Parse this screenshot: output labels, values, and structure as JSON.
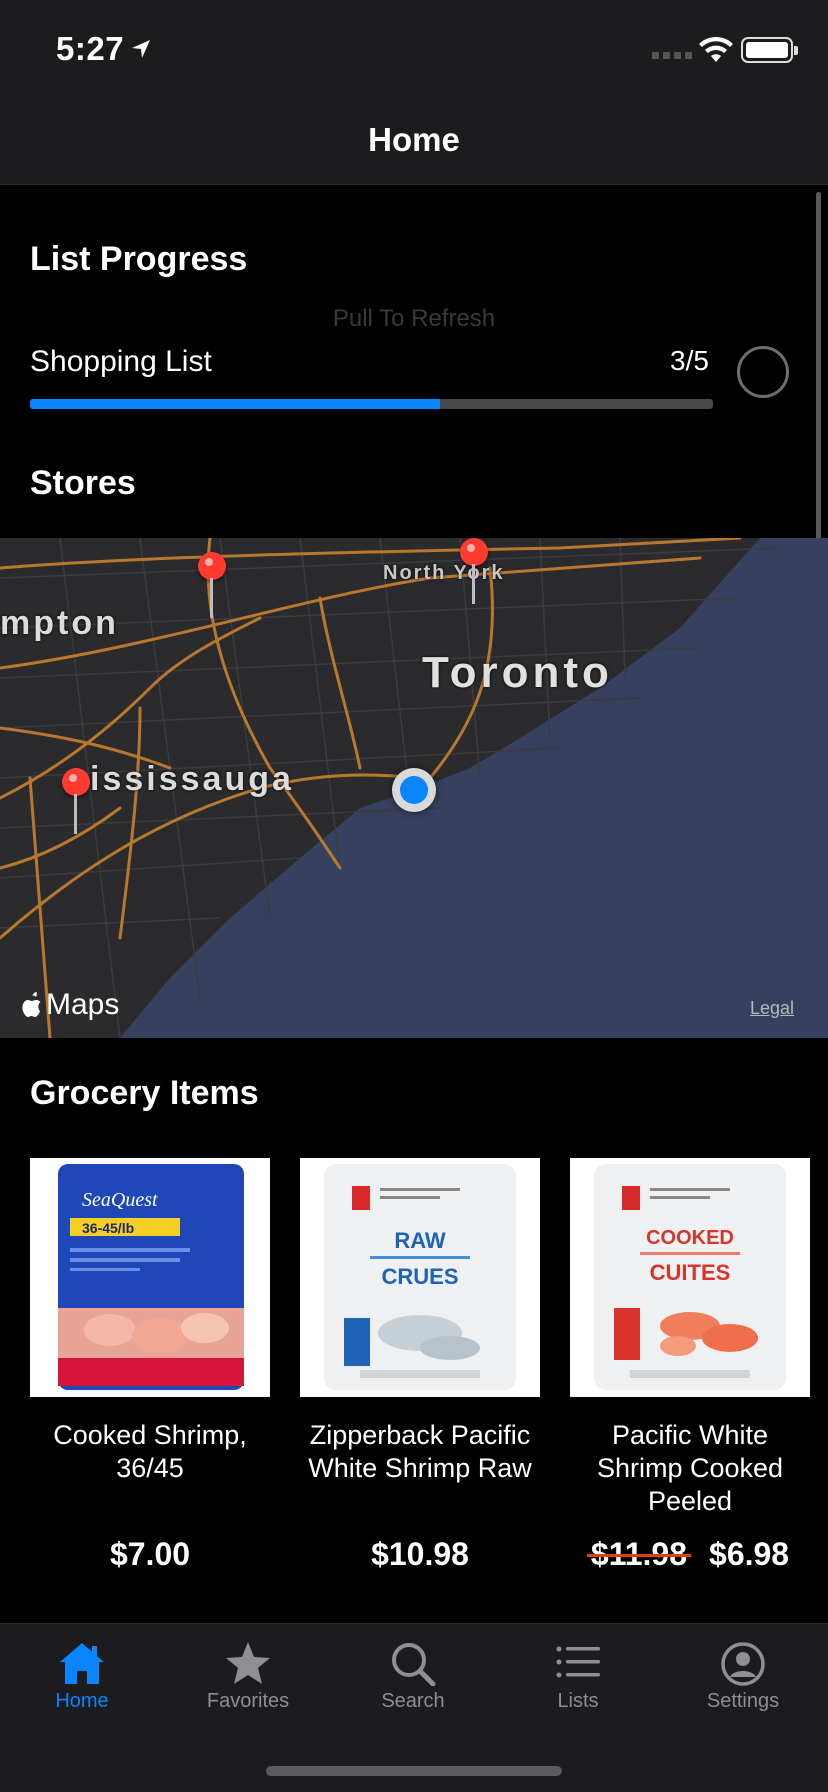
{
  "status": {
    "time": "5:27"
  },
  "nav": {
    "title": "Home"
  },
  "list_progress": {
    "title": "List Progress",
    "pull_to_refresh": "Pull To Refresh",
    "list_name": "Shopping List",
    "count": "3/5",
    "progress": 0.6
  },
  "stores": {
    "title": "Stores",
    "map_labels": {
      "north_york": "North York",
      "toronto": "Toronto",
      "mississauga": "ississauga",
      "brampton": "mpton"
    },
    "maps_brand": "Maps",
    "legal": "Legal"
  },
  "grocery": {
    "title": "Grocery Items",
    "items": [
      {
        "name": "Cooked Shrimp, 36/45",
        "price": "$7.00",
        "image": "seaquest-shrimp-bag"
      },
      {
        "name": "Zipperback Pacific White Shrimp Raw",
        "price": "$10.98",
        "image": "pc-raw-shrimp-bag"
      },
      {
        "name": "Pacific White Shrimp Cooked Peeled",
        "old_price": "$11.98",
        "price": "$6.98",
        "image": "pc-cooked-shrimp-bag"
      }
    ],
    "package_text": {
      "seaquest_brand": "SeaQuest",
      "seaquest_count": "36-45/lb",
      "pc_raw_label": "RAW",
      "pc_raw_fr": "CRUES",
      "pc_cooked_label": "COOKED",
      "pc_cooked_fr": "CUITES"
    }
  },
  "tabs": [
    {
      "label": "Home",
      "icon": "house-icon",
      "active": true
    },
    {
      "label": "Favorites",
      "icon": "star-icon",
      "active": false
    },
    {
      "label": "Search",
      "icon": "magnifier-icon",
      "active": false
    },
    {
      "label": "Lists",
      "icon": "list-icon",
      "active": false
    },
    {
      "label": "Settings",
      "icon": "person-circle-icon",
      "active": false
    }
  ],
  "colors": {
    "accent": "#0a84ff",
    "pin": "#ff3b30",
    "water": "#35415f",
    "roads": "#b9782e"
  }
}
